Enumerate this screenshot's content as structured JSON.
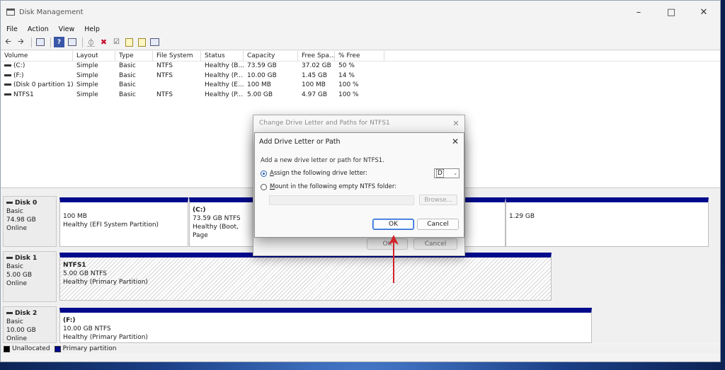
{
  "window": {
    "title": "Disk Management"
  },
  "menu": [
    "File",
    "Action",
    "View",
    "Help"
  ],
  "toolbar": {
    "icons": [
      "back-arrow-icon",
      "forward-arrow-icon",
      "console-tree-icon",
      "help-icon",
      "properties-icon",
      "connect-icon",
      "delete-icon",
      "check-icon",
      "new-doc-icon",
      "import-doc-icon",
      "view-icon"
    ]
  },
  "volume_list": {
    "columns": [
      "Volume",
      "Layout",
      "Type",
      "File System",
      "Status",
      "Capacity",
      "Free Spa...",
      "% Free"
    ],
    "rows": [
      [
        "(C:)",
        "Simple",
        "Basic",
        "NTFS",
        "Healthy (B...",
        "73.59 GB",
        "37.02 GB",
        "50 %"
      ],
      [
        "(F:)",
        "Simple",
        "Basic",
        "NTFS",
        "Healthy (P...",
        "10.00 GB",
        "1.45 GB",
        "14 %"
      ],
      [
        "(Disk 0 partition 1)",
        "Simple",
        "Basic",
        "",
        "Healthy (E...",
        "100 MB",
        "100 MB",
        "100 %"
      ],
      [
        "NTFS1",
        "Simple",
        "Basic",
        "NTFS",
        "Healthy (P...",
        "5.00 GB",
        "4.97 GB",
        "100 %"
      ]
    ]
  },
  "disks": [
    {
      "name": "Disk 0",
      "type": "Basic",
      "size": "74.98 GB",
      "state": "Online",
      "partitions": [
        {
          "name": "",
          "size": "100 MB",
          "status": "Healthy (EFI System Partition)"
        },
        {
          "name": "(C:)",
          "size": "73.59 GB NTFS",
          "status": "Healthy (Boot, Page"
        },
        {
          "name": "",
          "size": "1.29 GB",
          "status": ""
        }
      ]
    },
    {
      "name": "Disk 1",
      "type": "Basic",
      "size": "5.00 GB",
      "state": "Online",
      "partitions": [
        {
          "name": "NTFS1",
          "size": "5.00 GB NTFS",
          "status": "Healthy (Primary Partition)"
        }
      ]
    },
    {
      "name": "Disk 2",
      "type": "Basic",
      "size": "10.00 GB",
      "state": "Online",
      "partitions": [
        {
          "name": "(F:)",
          "size": "10.00 GB NTFS",
          "status": "Healthy (Primary Partition)"
        }
      ]
    }
  ],
  "legend": {
    "unallocated": "Unallocated",
    "primary": "Primary partition"
  },
  "dialog_back": {
    "title": "Change Drive Letter and Paths for NTFS1",
    "ok": "OK",
    "cancel": "Cancel"
  },
  "dialog_front": {
    "title": "Add Drive Letter or Path",
    "instruction": "Add a new drive letter or path for NTFS1.",
    "assign_prefix": "A",
    "assign_rest": "ssign the following drive letter:",
    "mount_prefix": "M",
    "mount_rest": "ount in the following empty NTFS folder:",
    "drive_letter": "D",
    "browse": "Browse...",
    "ok": "OK",
    "cancel": "Cancel"
  },
  "colors": {
    "primary_partition": "#000a8c",
    "annotation_arrow": "#d2232a"
  }
}
